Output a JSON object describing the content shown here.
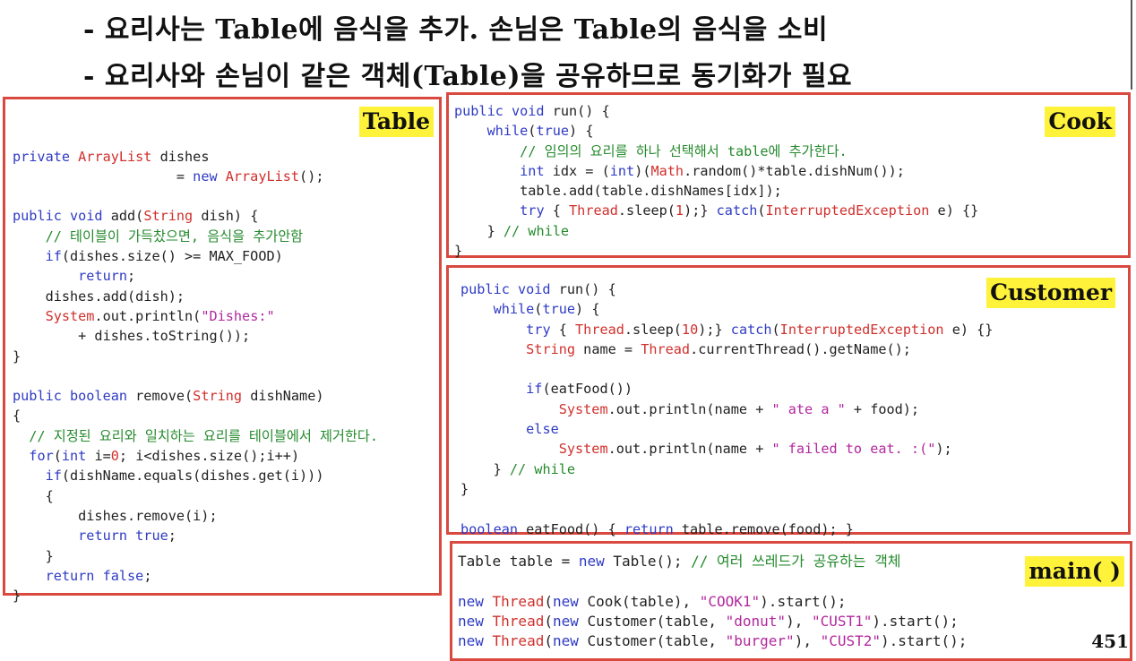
{
  "bullets": [
    "- 요리사는 Table에 음식을 추가. 손님은 Table의 음식을 소비",
    "- 요리사와 손님이 같은 객체(Table)을 공유하므로 동기화가 필요"
  ],
  "tags": {
    "table": "Table",
    "cook": "Cook",
    "customer": "Customer",
    "main": "main( )"
  },
  "page_number": "451",
  "colors": {
    "border": "#d9493f",
    "tag_bg": "#fff23a",
    "keyword": "#2f3bc4",
    "type": "#d0302c",
    "string": "#b2289e",
    "comment": "#248a2c"
  },
  "code": {
    "table": [
      [],
      [],
      [
        [
          "private ",
          "kw"
        ],
        [
          "ArrayList",
          "ty"
        ],
        [
          " dishes",
          ""
        ]
      ],
      [
        [
          "                    = ",
          ""
        ],
        [
          "new ",
          "kw"
        ],
        [
          "ArrayList",
          "ty"
        ],
        [
          "();",
          ""
        ]
      ],
      [],
      [
        [
          "public void ",
          "kw"
        ],
        [
          "add(",
          ""
        ],
        [
          "String",
          "ty"
        ],
        [
          " dish) {",
          ""
        ]
      ],
      [
        [
          "    // 테이블이 가득찼으면, 음식을 추가안함",
          "cm"
        ]
      ],
      [
        [
          "    ",
          ""
        ],
        [
          "if",
          "kw"
        ],
        [
          "(dishes.size() >= MAX_FOOD)",
          ""
        ]
      ],
      [
        [
          "        ",
          ""
        ],
        [
          "return",
          "kw"
        ],
        [
          ";",
          ""
        ]
      ],
      [
        [
          "    dishes.add(dish);",
          ""
        ]
      ],
      [
        [
          "    ",
          ""
        ],
        [
          "System",
          "ty"
        ],
        [
          ".out.println(",
          ""
        ],
        [
          "\"Dishes:\"",
          "str"
        ]
      ],
      [
        [
          "        + dishes.toString());",
          ""
        ]
      ],
      [
        [
          "}",
          ""
        ]
      ],
      [],
      [
        [
          "public boolean ",
          "kw"
        ],
        [
          "remove(",
          ""
        ],
        [
          "String",
          "ty"
        ],
        [
          " dishName)",
          ""
        ]
      ],
      [
        [
          "{",
          ""
        ]
      ],
      [
        [
          "  // 지정된 요리와 일치하는 요리를 테이블에서 제거한다.",
          "cm"
        ]
      ],
      [
        [
          "  ",
          ""
        ],
        [
          "for",
          "kw"
        ],
        [
          "(",
          ""
        ],
        [
          "int",
          "kw"
        ],
        [
          " i=",
          ""
        ],
        [
          "0",
          "num"
        ],
        [
          "; i<dishes.size();i++)",
          ""
        ]
      ],
      [
        [
          "    ",
          ""
        ],
        [
          "if",
          "kw"
        ],
        [
          "(dishName.equals(dishes.get(i)))",
          ""
        ]
      ],
      [
        [
          "    {",
          ""
        ]
      ],
      [
        [
          "        dishes.remove(i);",
          ""
        ]
      ],
      [
        [
          "        ",
          ""
        ],
        [
          "return true",
          "kw"
        ],
        [
          ";",
          ""
        ]
      ],
      [
        [
          "    }",
          ""
        ]
      ],
      [
        [
          "    ",
          ""
        ],
        [
          "return false",
          "kw"
        ],
        [
          ";",
          ""
        ]
      ],
      [
        [
          "}",
          ""
        ]
      ]
    ],
    "cook": [
      [
        [
          "public void ",
          "kw"
        ],
        [
          "run() {",
          ""
        ]
      ],
      [
        [
          "    ",
          ""
        ],
        [
          "while",
          "kw"
        ],
        [
          "(",
          ""
        ],
        [
          "true",
          "kw"
        ],
        [
          ") {",
          ""
        ]
      ],
      [
        [
          "        // 임의의 요리를 하나 선택해서 table에 추가한다.",
          "cm"
        ]
      ],
      [
        [
          "        ",
          ""
        ],
        [
          "int",
          "kw"
        ],
        [
          " idx = (",
          ""
        ],
        [
          "int",
          "kw"
        ],
        [
          ")(",
          ""
        ],
        [
          "Math",
          "ty"
        ],
        [
          ".random()*table.dishNum());",
          ""
        ]
      ],
      [
        [
          "        table.add(table.dishNames[idx]);",
          ""
        ]
      ],
      [
        [
          "        ",
          ""
        ],
        [
          "try",
          "kw"
        ],
        [
          " { ",
          ""
        ],
        [
          "Thread",
          "ty"
        ],
        [
          ".sleep(",
          ""
        ],
        [
          "1",
          "num"
        ],
        [
          ");} ",
          ""
        ],
        [
          "catch",
          "kw"
        ],
        [
          "(",
          ""
        ],
        [
          "InterruptedException",
          "ty"
        ],
        [
          " e) {}",
          ""
        ]
      ],
      [
        [
          "    } ",
          ""
        ],
        [
          "// while",
          "cm"
        ]
      ],
      [
        [
          "}",
          ""
        ]
      ]
    ],
    "customer": [
      [
        [
          "public void ",
          "kw"
        ],
        [
          "run() {",
          ""
        ]
      ],
      [
        [
          "    ",
          ""
        ],
        [
          "while",
          "kw"
        ],
        [
          "(",
          ""
        ],
        [
          "true",
          "kw"
        ],
        [
          ") {",
          ""
        ]
      ],
      [
        [
          "        ",
          ""
        ],
        [
          "try",
          "kw"
        ],
        [
          " { ",
          ""
        ],
        [
          "Thread",
          "ty"
        ],
        [
          ".sleep(",
          ""
        ],
        [
          "10",
          "num"
        ],
        [
          ");} ",
          ""
        ],
        [
          "catch",
          "kw"
        ],
        [
          "(",
          ""
        ],
        [
          "InterruptedException",
          "ty"
        ],
        [
          " e) {}",
          ""
        ]
      ],
      [
        [
          "        ",
          ""
        ],
        [
          "String",
          "ty"
        ],
        [
          " name = ",
          ""
        ],
        [
          "Thread",
          "ty"
        ],
        [
          ".currentThread().getName();",
          ""
        ]
      ],
      [],
      [
        [
          "        ",
          ""
        ],
        [
          "if",
          "kw"
        ],
        [
          "(eatFood())",
          ""
        ]
      ],
      [
        [
          "            ",
          ""
        ],
        [
          "System",
          "ty"
        ],
        [
          ".out.println(name + ",
          ""
        ],
        [
          "\" ate a \"",
          "str"
        ],
        [
          " + food);",
          ""
        ]
      ],
      [
        [
          "        ",
          ""
        ],
        [
          "else",
          "kw"
        ]
      ],
      [
        [
          "            ",
          ""
        ],
        [
          "System",
          "ty"
        ],
        [
          ".out.println(name + ",
          ""
        ],
        [
          "\" failed to eat. :(\"",
          "str"
        ],
        [
          ");",
          ""
        ]
      ],
      [
        [
          "    } ",
          ""
        ],
        [
          "// while",
          "cm"
        ]
      ],
      [
        [
          "}",
          ""
        ]
      ],
      [],
      [
        [
          "boolean ",
          "kw"
        ],
        [
          "eatFood() { ",
          ""
        ],
        [
          "return",
          "kw"
        ],
        [
          " table.remove(food); }",
          ""
        ]
      ]
    ],
    "main": [
      [
        [
          "Table table = ",
          ""
        ],
        [
          "new ",
          "kw"
        ],
        [
          "Table(); ",
          ""
        ],
        [
          "// 여러 쓰레드가 공유하는 객체",
          "cm"
        ]
      ],
      [],
      [
        [
          "new ",
          "kw"
        ],
        [
          "Thread",
          "ty"
        ],
        [
          "(",
          ""
        ],
        [
          "new ",
          "kw"
        ],
        [
          "Cook(table), ",
          ""
        ],
        [
          "\"COOK1\"",
          "str"
        ],
        [
          ").start();",
          ""
        ]
      ],
      [
        [
          "new ",
          "kw"
        ],
        [
          "Thread",
          "ty"
        ],
        [
          "(",
          ""
        ],
        [
          "new ",
          "kw"
        ],
        [
          "Customer(table, ",
          ""
        ],
        [
          "\"donut\"",
          "str"
        ],
        [
          "), ",
          ""
        ],
        [
          "\"CUST1\"",
          "str"
        ],
        [
          ").start();",
          ""
        ]
      ],
      [
        [
          "new ",
          "kw"
        ],
        [
          "Thread",
          "ty"
        ],
        [
          "(",
          ""
        ],
        [
          "new ",
          "kw"
        ],
        [
          "Customer(table, ",
          ""
        ],
        [
          "\"burger\"",
          "str"
        ],
        [
          "), ",
          ""
        ],
        [
          "\"CUST2\"",
          "str"
        ],
        [
          ").start();",
          ""
        ]
      ]
    ]
  }
}
